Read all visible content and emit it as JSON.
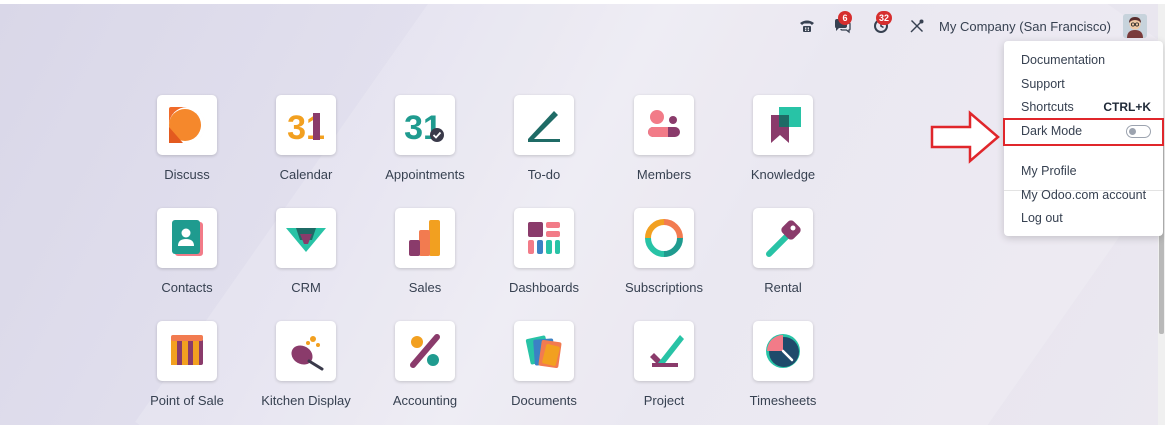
{
  "systray": {
    "phone_icon": "phone-icon",
    "chat_badge": "6",
    "activity_badge": "32",
    "debug_icon": "wrench-screwdriver-icon",
    "company": "My Company (San Francisco)"
  },
  "apps": [
    {
      "label": "Discuss",
      "icon": "discuss-icon"
    },
    {
      "label": "Calendar",
      "icon": "calendar-icon"
    },
    {
      "label": "Appointments",
      "icon": "appointments-icon"
    },
    {
      "label": "To-do",
      "icon": "todo-icon"
    },
    {
      "label": "Members",
      "icon": "members-icon"
    },
    {
      "label": "Knowledge",
      "icon": "knowledge-icon"
    },
    {
      "label": "Contacts",
      "icon": "contacts-icon"
    },
    {
      "label": "CRM",
      "icon": "crm-icon"
    },
    {
      "label": "Sales",
      "icon": "sales-icon"
    },
    {
      "label": "Dashboards",
      "icon": "dashboards-icon"
    },
    {
      "label": "Subscriptions",
      "icon": "subscriptions-icon"
    },
    {
      "label": "Rental",
      "icon": "rental-icon"
    },
    {
      "label": "Point of Sale",
      "icon": "pos-icon"
    },
    {
      "label": "Kitchen Display",
      "icon": "kitchen-display-icon"
    },
    {
      "label": "Accounting",
      "icon": "accounting-icon"
    },
    {
      "label": "Documents",
      "icon": "documents-icon"
    },
    {
      "label": "Project",
      "icon": "project-icon"
    },
    {
      "label": "Timesheets",
      "icon": "timesheets-icon"
    }
  ],
  "calendar_icon_text": "31",
  "user_menu": {
    "documentation": "Documentation",
    "support": "Support",
    "shortcuts": "Shortcuts",
    "shortcuts_key": "CTRL+K",
    "dark_mode": "Dark Mode",
    "dark_mode_on": false,
    "my_profile": "My Profile",
    "odoo_account": "My Odoo.com account",
    "logout": "Log out"
  },
  "colors": {
    "accent_red": "#e0262b",
    "badge_red": "#d62e2e"
  }
}
